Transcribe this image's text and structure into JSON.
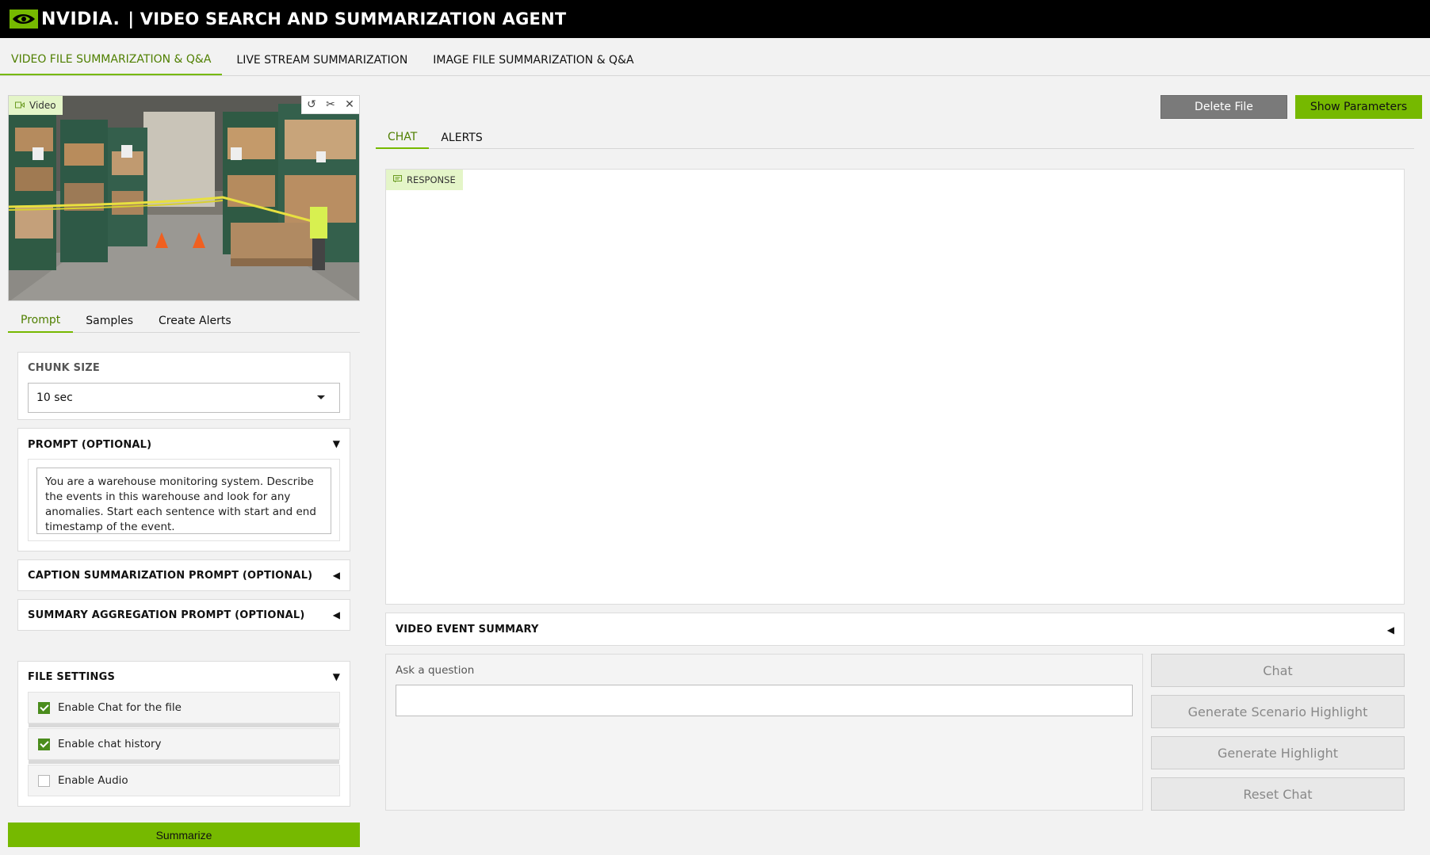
{
  "header": {
    "brand": "NVIDIA.",
    "title": "| VIDEO SEARCH AND SUMMARIZATION AGENT"
  },
  "main_tabs": [
    {
      "label": "VIDEO FILE SUMMARIZATION & Q&A",
      "active": true
    },
    {
      "label": "LIVE STREAM SUMMARIZATION",
      "active": false
    },
    {
      "label": "IMAGE FILE SUMMARIZATION & Q&A",
      "active": false
    }
  ],
  "video": {
    "label": "Video",
    "tools": [
      "undo-icon",
      "scissors-icon",
      "close-icon"
    ]
  },
  "sub_tabs": [
    {
      "label": "Prompt",
      "active": true
    },
    {
      "label": "Samples",
      "active": false
    },
    {
      "label": "Create Alerts",
      "active": false
    }
  ],
  "chunk_size": {
    "title": "CHUNK SIZE",
    "value": "10 sec"
  },
  "prompt": {
    "title": "PROMPT (OPTIONAL)",
    "text": "You are a warehouse monitoring system. Describe the events in this warehouse and look for any anomalies. Start each sentence with start and end timestamp of the event."
  },
  "caption_prompt": {
    "title": "CAPTION SUMMARIZATION PROMPT (OPTIONAL)"
  },
  "aggregation_prompt": {
    "title": "SUMMARY AGGREGATION PROMPT (OPTIONAL)"
  },
  "file_settings": {
    "title": "FILE SETTINGS",
    "options": [
      {
        "label": "Enable Chat for the file",
        "checked": true
      },
      {
        "label": "Enable chat history",
        "checked": true
      },
      {
        "label": "Enable Audio",
        "checked": false
      }
    ]
  },
  "summarize_label": "Summarize",
  "actions": {
    "delete_label": "Delete File",
    "show_params_label": "Show Parameters"
  },
  "chat_tabs": [
    {
      "label": "CHAT",
      "active": true
    },
    {
      "label": "ALERTS",
      "active": false
    }
  ],
  "response": {
    "label": "RESPONSE"
  },
  "video_event_summary": {
    "title": "VIDEO EVENT SUMMARY"
  },
  "ask": {
    "label": "Ask a question",
    "value": ""
  },
  "side_buttons": {
    "chat": "Chat",
    "scenario": "Generate Scenario Highlight",
    "highlight": "Generate Highlight",
    "reset": "Reset Chat"
  },
  "colors": {
    "accent": "#76b900",
    "accent_text": "#4f7f00",
    "header_bg": "#000000",
    "label_bg": "#e4f5c8"
  }
}
